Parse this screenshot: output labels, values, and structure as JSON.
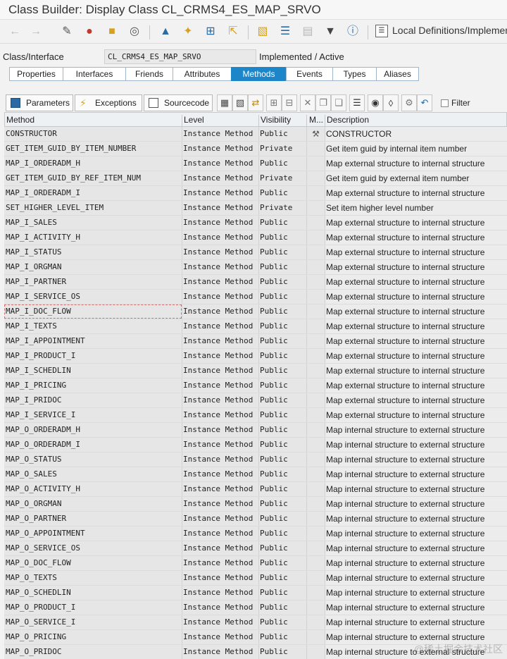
{
  "window": {
    "title": "Class Builder: Display Class CL_CRMS4_ES_MAP_SRVO"
  },
  "toolbar": {
    "local_definitions": "Local Definitions/Implemen"
  },
  "header": {
    "class_label": "Class/Interface",
    "class_value": "CL_CRMS4_ES_MAP_SRVO",
    "status": "Implemented / Active"
  },
  "tabs": [
    "Properties",
    "Interfaces",
    "Friends",
    "Attributes",
    "Methods",
    "Events",
    "Types",
    "Aliases"
  ],
  "active_tab": "Methods",
  "grid_toolbar": {
    "parameters": "Parameters",
    "exceptions": "Exceptions",
    "sourcecode": "Sourcecode",
    "filter": "Filter"
  },
  "columns": [
    "Method",
    "Level",
    "Visibility",
    "M...",
    "Description"
  ],
  "rows": [
    {
      "method": "CONSTRUCTOR",
      "level": "Instance Method",
      "visibility": "Public",
      "m": "⚒",
      "description": "CONSTRUCTOR"
    },
    {
      "method": "GET_ITEM_GUID_BY_ITEM_NUMBER",
      "level": "Instance Method",
      "visibility": "Private",
      "m": "",
      "description": "Get item guid by internal item number"
    },
    {
      "method": "MAP_I_ORDERADM_H",
      "level": "Instance Method",
      "visibility": "Public",
      "m": "",
      "description": "Map external structure to internal structure"
    },
    {
      "method": "GET_ITEM_GUID_BY_REF_ITEM_NUM",
      "level": "Instance Method",
      "visibility": "Private",
      "m": "",
      "description": "Get item guid by external item number"
    },
    {
      "method": "MAP_I_ORDERADM_I",
      "level": "Instance Method",
      "visibility": "Public",
      "m": "",
      "description": "Map external structure to internal structure"
    },
    {
      "method": "SET_HIGHER_LEVEL_ITEM",
      "level": "Instance Method",
      "visibility": "Private",
      "m": "",
      "description": "Set item higher level number"
    },
    {
      "method": "MAP_I_SALES",
      "level": "Instance Method",
      "visibility": "Public",
      "m": "",
      "description": "Map external structure to internal structure"
    },
    {
      "method": "MAP_I_ACTIVITY_H",
      "level": "Instance Method",
      "visibility": "Public",
      "m": "",
      "description": "Map external structure to internal structure"
    },
    {
      "method": "MAP_I_STATUS",
      "level": "Instance Method",
      "visibility": "Public",
      "m": "",
      "description": "Map external structure to internal structure"
    },
    {
      "method": "MAP_I_ORGMAN",
      "level": "Instance Method",
      "visibility": "Public",
      "m": "",
      "description": "Map external structure to internal structure"
    },
    {
      "method": "MAP_I_PARTNER",
      "level": "Instance Method",
      "visibility": "Public",
      "m": "",
      "description": "Map external structure to internal structure"
    },
    {
      "method": "MAP_I_SERVICE_OS",
      "level": "Instance Method",
      "visibility": "Public",
      "m": "",
      "description": "Map external structure to internal structure"
    },
    {
      "method": "MAP_I_DOC_FLOW",
      "level": "Instance Method",
      "visibility": "Public",
      "m": "",
      "description": "Map external structure to internal structure"
    },
    {
      "method": "MAP_I_TEXTS",
      "level": "Instance Method",
      "visibility": "Public",
      "m": "",
      "description": "Map external structure to internal structure"
    },
    {
      "method": "MAP_I_APPOINTMENT",
      "level": "Instance Method",
      "visibility": "Public",
      "m": "",
      "description": "Map external structure to internal structure"
    },
    {
      "method": "MAP_I_PRODUCT_I",
      "level": "Instance Method",
      "visibility": "Public",
      "m": "",
      "description": "Map external structure to internal structure"
    },
    {
      "method": "MAP_I_SCHEDLIN",
      "level": "Instance Method",
      "visibility": "Public",
      "m": "",
      "description": "Map external structure to internal structure"
    },
    {
      "method": "MAP_I_PRICING",
      "level": "Instance Method",
      "visibility": "Public",
      "m": "",
      "description": "Map external structure to internal structure"
    },
    {
      "method": "MAP_I_PRIDOC",
      "level": "Instance Method",
      "visibility": "Public",
      "m": "",
      "description": "Map external structure to internal structure"
    },
    {
      "method": "MAP_I_SERVICE_I",
      "level": "Instance Method",
      "visibility": "Public",
      "m": "",
      "description": "Map external structure to internal structure"
    },
    {
      "method": "MAP_O_ORDERADM_H",
      "level": "Instance Method",
      "visibility": "Public",
      "m": "",
      "description": "Map internal structure to external structure"
    },
    {
      "method": "MAP_O_ORDERADM_I",
      "level": "Instance Method",
      "visibility": "Public",
      "m": "",
      "description": "Map internal structure to external structure"
    },
    {
      "method": "MAP_O_STATUS",
      "level": "Instance Method",
      "visibility": "Public",
      "m": "",
      "description": "Map internal structure to external structure"
    },
    {
      "method": "MAP_O_SALES",
      "level": "Instance Method",
      "visibility": "Public",
      "m": "",
      "description": "Map internal structure to external structure"
    },
    {
      "method": "MAP_O_ACTIVITY_H",
      "level": "Instance Method",
      "visibility": "Public",
      "m": "",
      "description": "Map internal structure to external structure"
    },
    {
      "method": "MAP_O_ORGMAN",
      "level": "Instance Method",
      "visibility": "Public",
      "m": "",
      "description": "Map internal structure to external structure"
    },
    {
      "method": "MAP_O_PARTNER",
      "level": "Instance Method",
      "visibility": "Public",
      "m": "",
      "description": "Map internal structure to external structure"
    },
    {
      "method": "MAP_O_APPOINTMENT",
      "level": "Instance Method",
      "visibility": "Public",
      "m": "",
      "description": "Map internal structure to external structure"
    },
    {
      "method": "MAP_O_SERVICE_OS",
      "level": "Instance Method",
      "visibility": "Public",
      "m": "",
      "description": "Map internal structure to external structure"
    },
    {
      "method": "MAP_O_DOC_FLOW",
      "level": "Instance Method",
      "visibility": "Public",
      "m": "",
      "description": "Map internal structure to external structure"
    },
    {
      "method": "MAP_O_TEXTS",
      "level": "Instance Method",
      "visibility": "Public",
      "m": "",
      "description": "Map internal structure to external structure"
    },
    {
      "method": "MAP_O_SCHEDLIN",
      "level": "Instance Method",
      "visibility": "Public",
      "m": "",
      "description": "Map internal structure to external structure"
    },
    {
      "method": "MAP_O_PRODUCT_I",
      "level": "Instance Method",
      "visibility": "Public",
      "m": "",
      "description": "Map internal structure to external structure"
    },
    {
      "method": "MAP_O_SERVICE_I",
      "level": "Instance Method",
      "visibility": "Public",
      "m": "",
      "description": "Map internal structure to external structure"
    },
    {
      "method": "MAP_O_PRICING",
      "level": "Instance Method",
      "visibility": "Public",
      "m": "",
      "description": "Map internal structure to external structure"
    },
    {
      "method": "MAP_O_PRIDOC",
      "level": "Instance Method",
      "visibility": "Public",
      "m": "",
      "description": "Map internal structure to external structure"
    }
  ],
  "watermark": "@稀土掘金技术社区"
}
